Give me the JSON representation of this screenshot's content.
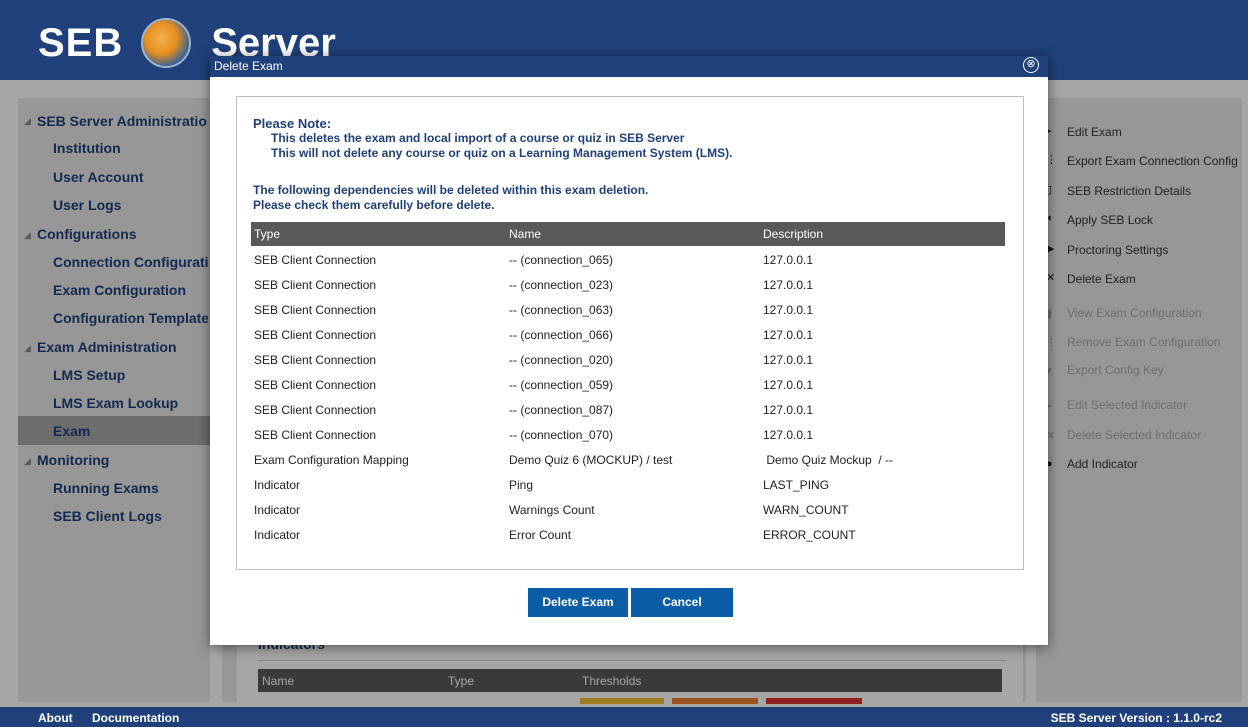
{
  "app": {
    "logo_left": "SEB",
    "logo_right": "Server"
  },
  "nav": {
    "groups": [
      {
        "label": "SEB Server Administration",
        "items": [
          "Institution",
          "User Account",
          "User Logs"
        ]
      },
      {
        "label": "Configurations",
        "items": [
          "Connection Configuration",
          "Exam Configuration",
          "Configuration Template"
        ]
      },
      {
        "label": "Exam Administration",
        "items": [
          "LMS Setup",
          "LMS Exam Lookup",
          "Exam"
        ]
      },
      {
        "label": "Monitoring",
        "items": [
          "Running Exams",
          "SEB Client Logs"
        ]
      }
    ],
    "selected": "Exam"
  },
  "actions": [
    {
      "label": "Edit Exam",
      "enabled": true,
      "icon": "edit-icon"
    },
    {
      "label": "Export Exam Connection Config",
      "enabled": true,
      "icon": "export-icon"
    },
    {
      "label": "SEB Restriction Details",
      "enabled": true,
      "icon": "restriction-icon"
    },
    {
      "label": "Apply SEB Lock",
      "enabled": true,
      "icon": "lock-icon"
    },
    {
      "label": "Proctoring Settings",
      "enabled": true,
      "icon": "proctoring-icon"
    },
    {
      "label": "Delete Exam",
      "enabled": true,
      "icon": "delete-icon"
    },
    {
      "label": "View Exam Configuration",
      "enabled": false,
      "icon": "view-icon"
    },
    {
      "label": "Remove Exam Configuration",
      "enabled": false,
      "icon": "remove-icon"
    },
    {
      "label": "Export Config Key",
      "enabled": false,
      "icon": "key-icon"
    },
    {
      "label": "Edit Selected Indicator",
      "enabled": false,
      "icon": "edit-icon"
    },
    {
      "label": "Delete Selected Indicator",
      "enabled": false,
      "icon": "delete-icon"
    },
    {
      "label": "Add Indicator",
      "enabled": true,
      "icon": "add-icon"
    }
  ],
  "indicators_section": {
    "title": "Indicators",
    "columns": [
      "Name",
      "Type",
      "Thresholds"
    ]
  },
  "dialog": {
    "title": "Delete Exam",
    "note_title": "Please Note:",
    "note_line1": "This deletes the exam and local import of a course or quiz in SEB Server",
    "note_line2": "This will not delete any course or quiz on a Learning Management System (LMS).",
    "dependency_line1": "The following dependencies will be deleted within this exam deletion.",
    "dependency_line2": "Please check them carefully before delete.",
    "columns": [
      "Type",
      "Name",
      "Description"
    ],
    "rows": [
      [
        "SEB Client Connection",
        "-- (connection_065)",
        "127.0.0.1"
      ],
      [
        "SEB Client Connection",
        "-- (connection_023)",
        "127.0.0.1"
      ],
      [
        "SEB Client Connection",
        "-- (connection_063)",
        "127.0.0.1"
      ],
      [
        "SEB Client Connection",
        "-- (connection_066)",
        "127.0.0.1"
      ],
      [
        "SEB Client Connection",
        "-- (connection_020)",
        "127.0.0.1"
      ],
      [
        "SEB Client Connection",
        "-- (connection_059)",
        "127.0.0.1"
      ],
      [
        "SEB Client Connection",
        "-- (connection_087)",
        "127.0.0.1"
      ],
      [
        "SEB Client Connection",
        "-- (connection_070)",
        "127.0.0.1"
      ],
      [
        "Exam Configuration Mapping",
        "Demo Quiz 6 (MOCKUP) / test",
        " Demo Quiz Mockup  / --"
      ],
      [
        "Indicator",
        "Ping",
        "LAST_PING"
      ],
      [
        "Indicator",
        "Warnings Count",
        "WARN_COUNT"
      ],
      [
        "Indicator",
        "Error Count",
        "ERROR_COUNT"
      ]
    ],
    "delete_button": "Delete Exam",
    "cancel_button": "Cancel",
    "close_glyph": "⊗"
  },
  "footer": {
    "about": "About",
    "documentation": "Documentation",
    "version": "SEB Server Version : 1.1.0-rc2"
  },
  "colors": {
    "brand": "#1f407a",
    "button": "#0a5ea8",
    "table_header": "#595959"
  }
}
